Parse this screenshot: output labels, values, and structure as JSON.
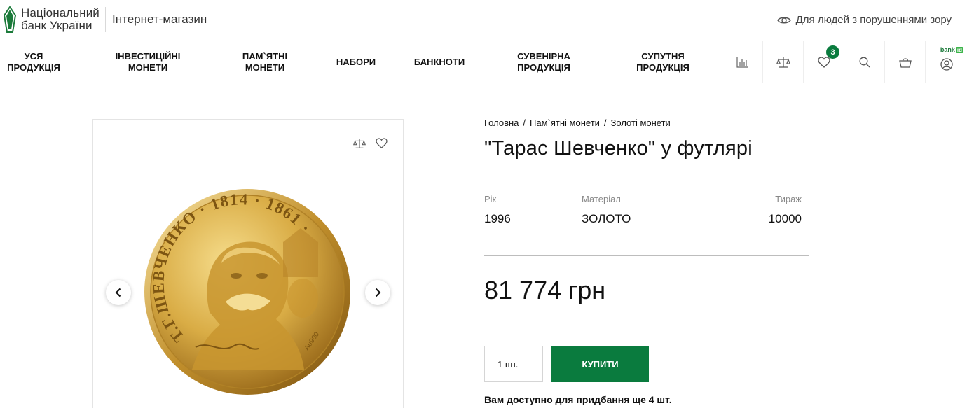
{
  "header": {
    "logo_line1": "Національний",
    "logo_line2": "банк України",
    "shop_title": "Інтернет-магазин",
    "vision_label": "Для людей з порушеннями зору"
  },
  "nav": {
    "items": [
      {
        "label": "УСЯ\nПРОДУКЦІЯ"
      },
      {
        "label": "ІНВЕСТИЦІЙНІ\nМОНЕТИ"
      },
      {
        "label": "ПАМ`ЯТНІ\nМОНЕТИ"
      },
      {
        "label": "НАБОРИ"
      },
      {
        "label": "БАНКНОТИ"
      },
      {
        "label": "СУВЕНІРНА\nПРОДУКЦІЯ"
      },
      {
        "label": "СУПУТНЯ\nПРОДУКЦІЯ"
      }
    ],
    "icons": [
      "chart-icon",
      "compare-icon",
      "heart-icon",
      "search-icon",
      "cart-icon",
      "user-icon"
    ],
    "wishlist_count": "3",
    "bankid_label": "bank",
    "bankid_box": "id"
  },
  "breadcrumb": [
    "Головна",
    "Пам`ятні монети",
    "Золоті монети"
  ],
  "breadcrumb_sep": "/",
  "product": {
    "title": "\"Тарас Шевченко\" у футлярі",
    "specs": [
      {
        "label": "Рік",
        "value": "1996"
      },
      {
        "label": "Матеріал",
        "value": "ЗОЛОТО"
      },
      {
        "label": "Тираж",
        "value": "10000"
      }
    ],
    "price": "81 774 грн",
    "quantity": "1 шт.",
    "buy_label": "КУПИТИ",
    "availability": "Вам доступно для придбання ще 4 шт."
  },
  "coin": {
    "inscription": "Т.Г.ШЕВЧЕНКО · 1814 · 1861 ·",
    "metal_mark": "Au900",
    "colors": {
      "gold_light": "#f3d27a",
      "gold_mid": "#d7a83e",
      "gold_dark": "#8f6216"
    }
  },
  "colors": {
    "accent": "#0a7b3e"
  }
}
